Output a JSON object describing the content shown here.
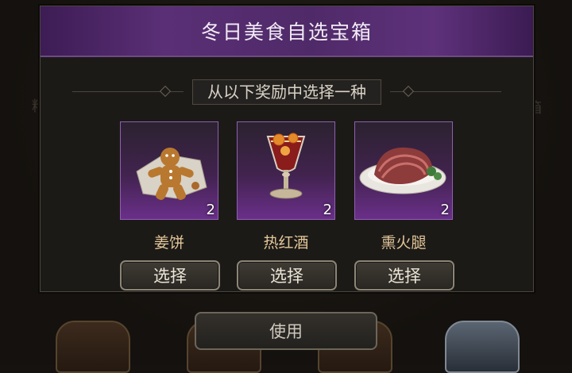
{
  "dialog": {
    "title": "冬日美食自选宝箱",
    "subtitle": "从以下奖励中选择一种",
    "items": [
      {
        "name": "姜饼",
        "quantity": "2",
        "button": "选择",
        "icon": "gingerbread-icon"
      },
      {
        "name": "热红酒",
        "quantity": "2",
        "button": "选择",
        "icon": "mulled-wine-icon"
      },
      {
        "name": "熏火腿",
        "quantity": "2",
        "button": "选择",
        "icon": "smoked-ham-icon"
      }
    ]
  },
  "use_button": "使用",
  "colors": {
    "header_purple": "#4f2a68",
    "item_name": "#e3c79a",
    "slot_purple": "#6a2f8a"
  }
}
